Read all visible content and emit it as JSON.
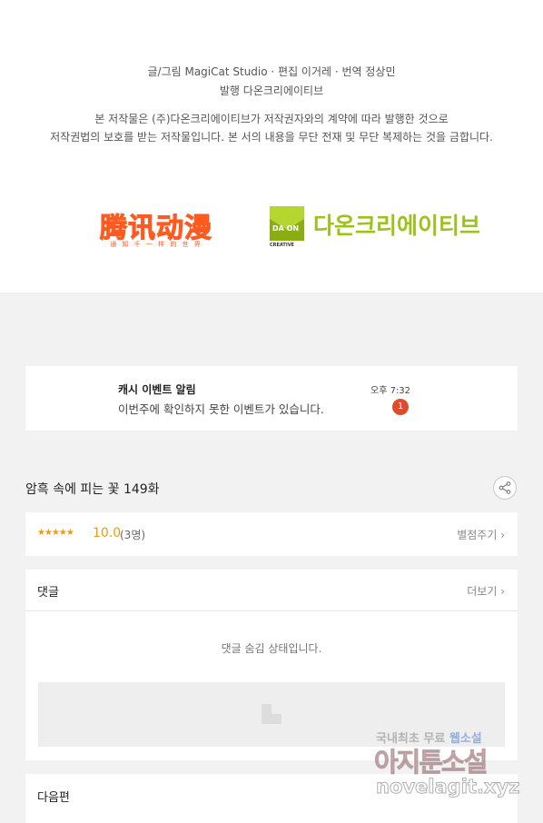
{
  "credits": {
    "line1": "글/그림 MagiCat Studio · 편집 이거레 · 번역 정상민",
    "line2": "발행 다온크리에이티브",
    "line3": "본 저작물은 (주)다온크리에이티브가 저작권자와의 계약에 따라 발행한 것으로",
    "line4": "저작권법의 보호를 받는 저작물입니다. 본 서의 내용을 무단 전재 및 무단 복제하는 것을 금합니다."
  },
  "logos": {
    "tencent_text": "腾讯动漫",
    "tencent_sub": "通 知 千 一 样 的 世 界",
    "daon_mark_text": "DA ON",
    "daon_mark_sub": "CREATIVE",
    "daon_name": "다온크리에이티브",
    "colors": {
      "tencent": "#ff5a1f",
      "daon": "#9bc31c"
    }
  },
  "notification": {
    "title": "캐시 이벤트 알림",
    "message": "이번주에 확인하지 못한 이벤트가 있습니다.",
    "time": "오후 7:32",
    "badge": "1"
  },
  "episode": {
    "title": "암흑 속에 피는 꽃 149화",
    "share_icon": "share-icon"
  },
  "rating": {
    "stars": "★★★★★",
    "score": "10.0",
    "count": "(3명)",
    "rate_link": "별점주기 ›"
  },
  "comments": {
    "label": "댓글",
    "more": "더보기 ›",
    "hidden_message": "댓글 숨김 상태입니다."
  },
  "next": {
    "label": "다음편"
  },
  "watermark": {
    "line1a": "국내최초 무료 ",
    "line1b": "웹소설",
    "line2": "아지툰소설",
    "line3": "novelagit.xyz"
  }
}
